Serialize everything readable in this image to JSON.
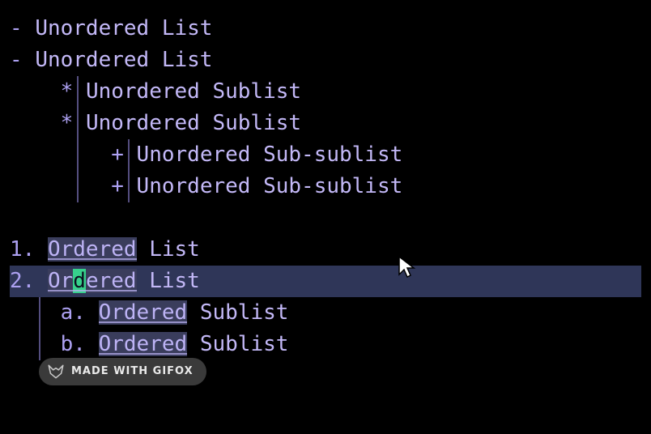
{
  "unordered": {
    "marker_l0": "- ",
    "text_l0_a": "Unordered List",
    "text_l0_b": "Unordered List",
    "marker_l1": "* ",
    "text_l1_a": "Unordered Sublist",
    "text_l1_b": "Unordered Sublist",
    "marker_l2": "+ ",
    "text_l2_a": "Unordered Sub-sublist",
    "text_l2_b": "Unordered Sub-sublist"
  },
  "ordered": {
    "num1": "1.",
    "num2": "2.",
    "word_ordered": "Ordered",
    "cursor_pre": "Or",
    "cursor_char": "d",
    "cursor_post": "ered",
    "rest_list": " List",
    "sub_a": "a.",
    "sub_b": "b.",
    "rest_sublist": " Sublist"
  },
  "badge": {
    "text": "MADE WITH GIFOX"
  }
}
